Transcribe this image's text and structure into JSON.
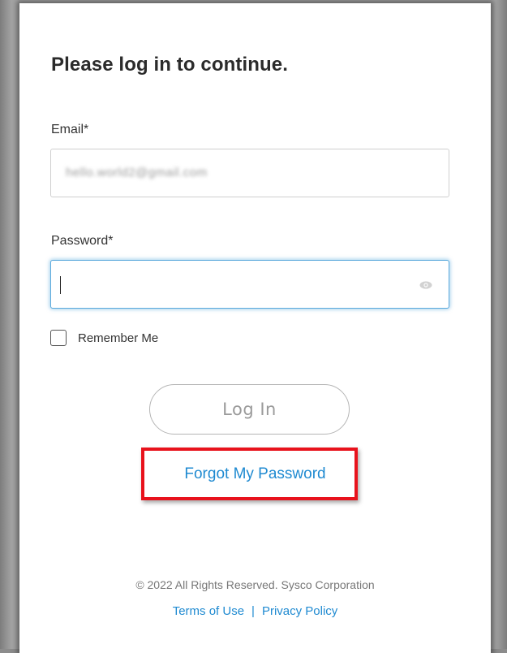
{
  "login": {
    "title": "Please log in to continue.",
    "email_label": "Email*",
    "email_value": "hello.world2@gmail.com",
    "password_label": "Password*",
    "password_value": "",
    "remember_label": "Remember Me",
    "remember_checked": false,
    "login_button": "Log In",
    "forgot_link": "Forgot My Password"
  },
  "footer": {
    "copyright": "© 2022 All Rights Reserved. Sysco Corporation",
    "terms": "Terms of Use",
    "separator": "|",
    "privacy": "Privacy Policy"
  },
  "colors": {
    "link": "#1f8ad1",
    "highlight": "#e8121c",
    "focus": "#5aa9dc"
  },
  "icons": {
    "password_toggle": "eye-icon"
  }
}
